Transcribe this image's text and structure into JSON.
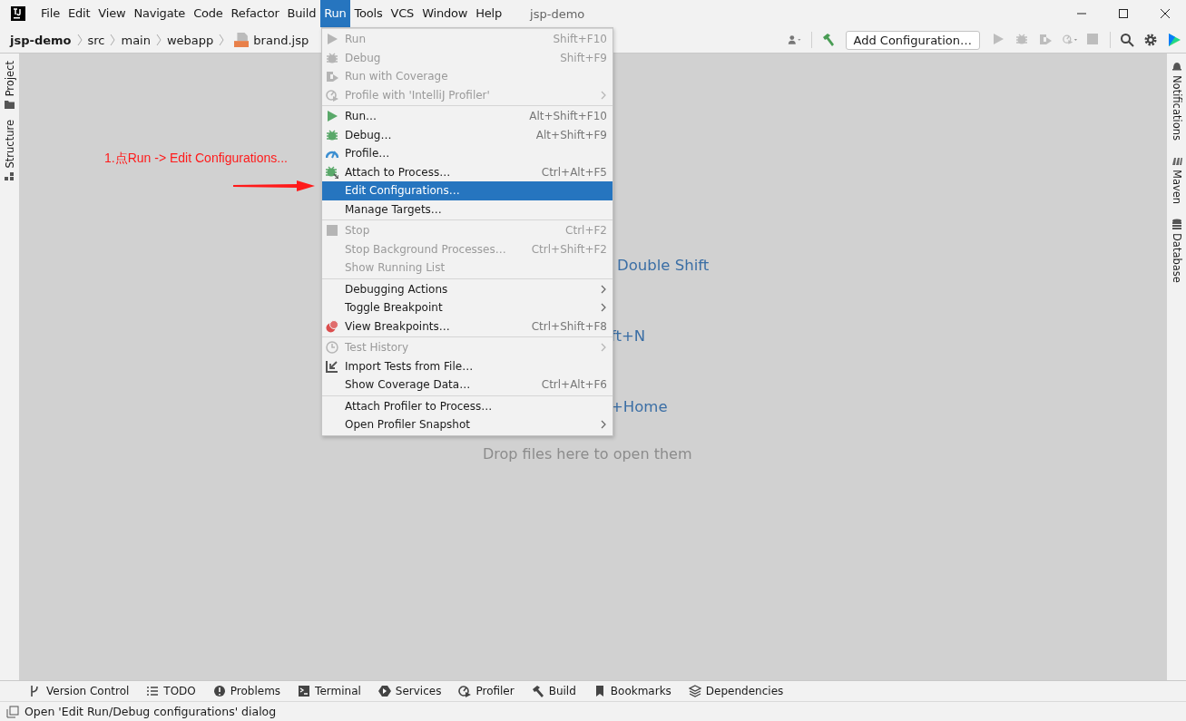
{
  "window": {
    "title": "jsp-demo"
  },
  "menu_bar": [
    {
      "label": "File",
      "selected": false
    },
    {
      "label": "Edit",
      "selected": false
    },
    {
      "label": "View",
      "selected": false
    },
    {
      "label": "Navigate",
      "selected": false
    },
    {
      "label": "Code",
      "selected": false
    },
    {
      "label": "Refactor",
      "selected": false
    },
    {
      "label": "Build",
      "selected": false
    },
    {
      "label": "Run",
      "selected": true
    },
    {
      "label": "Tools",
      "selected": false
    },
    {
      "label": "VCS",
      "selected": false
    },
    {
      "label": "Window",
      "selected": false
    },
    {
      "label": "Help",
      "selected": false
    }
  ],
  "breadcrumbs": [
    "jsp-demo",
    "src",
    "main",
    "webapp",
    "brand.jsp"
  ],
  "toolbar": {
    "run_configuration": "Add Configuration…"
  },
  "run_menu": [
    [
      {
        "label": "Run",
        "shortcut": "Shift+F10",
        "disabled": true,
        "submenu": false,
        "selected": false
      },
      {
        "label": "Debug",
        "shortcut": "Shift+F9",
        "disabled": true,
        "submenu": false,
        "selected": false
      },
      {
        "label": "Run with Coverage",
        "disabled": true,
        "submenu": false,
        "selected": false
      },
      {
        "label": "Profile with 'IntelliJ Profiler'",
        "disabled": true,
        "submenu": true,
        "selected": false
      }
    ],
    [
      {
        "label": "Run…",
        "shortcut": "Alt+Shift+F10",
        "disabled": false,
        "submenu": false,
        "selected": false
      },
      {
        "label": "Debug…",
        "shortcut": "Alt+Shift+F9",
        "disabled": false,
        "submenu": false,
        "selected": false
      },
      {
        "label": "Profile…",
        "disabled": false,
        "submenu": false,
        "selected": false
      },
      {
        "label": "Attach to Process…",
        "shortcut": "Ctrl+Alt+F5",
        "disabled": false,
        "submenu": false,
        "selected": false
      },
      {
        "label": "Edit Configurations…",
        "disabled": false,
        "submenu": false,
        "selected": true
      },
      {
        "label": "Manage Targets…",
        "disabled": false,
        "submenu": false,
        "selected": false
      }
    ],
    [
      {
        "label": "Stop",
        "shortcut": "Ctrl+F2",
        "disabled": true,
        "submenu": false,
        "selected": false
      },
      {
        "label": "Stop Background Processes…",
        "shortcut": "Ctrl+Shift+F2",
        "disabled": true,
        "submenu": false,
        "selected": false
      },
      {
        "label": "Show Running List",
        "disabled": true,
        "submenu": false,
        "selected": false
      }
    ],
    [
      {
        "label": "Debugging Actions",
        "disabled": false,
        "submenu": true,
        "selected": false
      },
      {
        "label": "Toggle Breakpoint",
        "disabled": false,
        "submenu": true,
        "selected": false
      },
      {
        "label": "View Breakpoints…",
        "shortcut": "Ctrl+Shift+F8",
        "disabled": false,
        "submenu": false,
        "selected": false
      }
    ],
    [
      {
        "label": "Test History",
        "disabled": true,
        "submenu": true,
        "selected": false
      },
      {
        "label": "Import Tests from File…",
        "disabled": false,
        "submenu": false,
        "selected": false
      },
      {
        "label": "Show Coverage Data…",
        "shortcut": "Ctrl+Alt+F6",
        "disabled": false,
        "submenu": false,
        "selected": false
      }
    ],
    [
      {
        "label": "Attach Profiler to Process…",
        "disabled": false,
        "submenu": false,
        "selected": false
      },
      {
        "label": "Open Profiler Snapshot",
        "disabled": false,
        "submenu": true,
        "selected": false
      }
    ]
  ],
  "editor": {
    "hints": [
      "Double Shift",
      "ft+N",
      "+Home"
    ],
    "drop_hint": "Drop files here to open them"
  },
  "annotation": {
    "text": "1.点Run -> Edit Configurations..."
  },
  "left_stripe": [
    "Project",
    "Structure"
  ],
  "right_stripe": [
    "Notifications",
    "Maven",
    "Database"
  ],
  "tool_windows": [
    "Version Control",
    "TODO",
    "Problems",
    "Terminal",
    "Services",
    "Profiler",
    "Build",
    "Bookmarks",
    "Dependencies"
  ],
  "status_bar": {
    "message": "Open 'Edit Run/Debug configurations' dialog"
  }
}
